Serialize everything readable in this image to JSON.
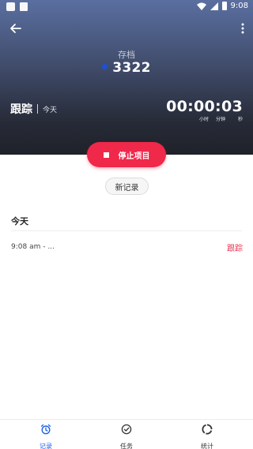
{
  "status_bar": {
    "time": "9:08"
  },
  "project": {
    "label": "存档",
    "number": "3322",
    "dot_color": "#1e4fd6"
  },
  "tracking": {
    "title": "跟踪",
    "date": "今天"
  },
  "timer": {
    "value": "00:00:03",
    "unit_hours": "小时",
    "unit_minutes": "分钟",
    "unit_seconds": "秒"
  },
  "actions": {
    "stop_label": "停止项目",
    "new_record_label": "新记录"
  },
  "records": {
    "section_title": "今天",
    "entries": [
      {
        "time": "9:08 am - ...",
        "tag": "跟踪"
      }
    ]
  },
  "bottom_nav": {
    "items": [
      {
        "label": "记录",
        "icon": "alarm-clock-icon",
        "active": true
      },
      {
        "label": "任务",
        "icon": "check-circle-icon",
        "active": false
      },
      {
        "label": "统计",
        "icon": "stats-ring-icon",
        "active": false
      }
    ]
  },
  "colors": {
    "accent": "#1e63e9",
    "danger": "#f0284a"
  }
}
